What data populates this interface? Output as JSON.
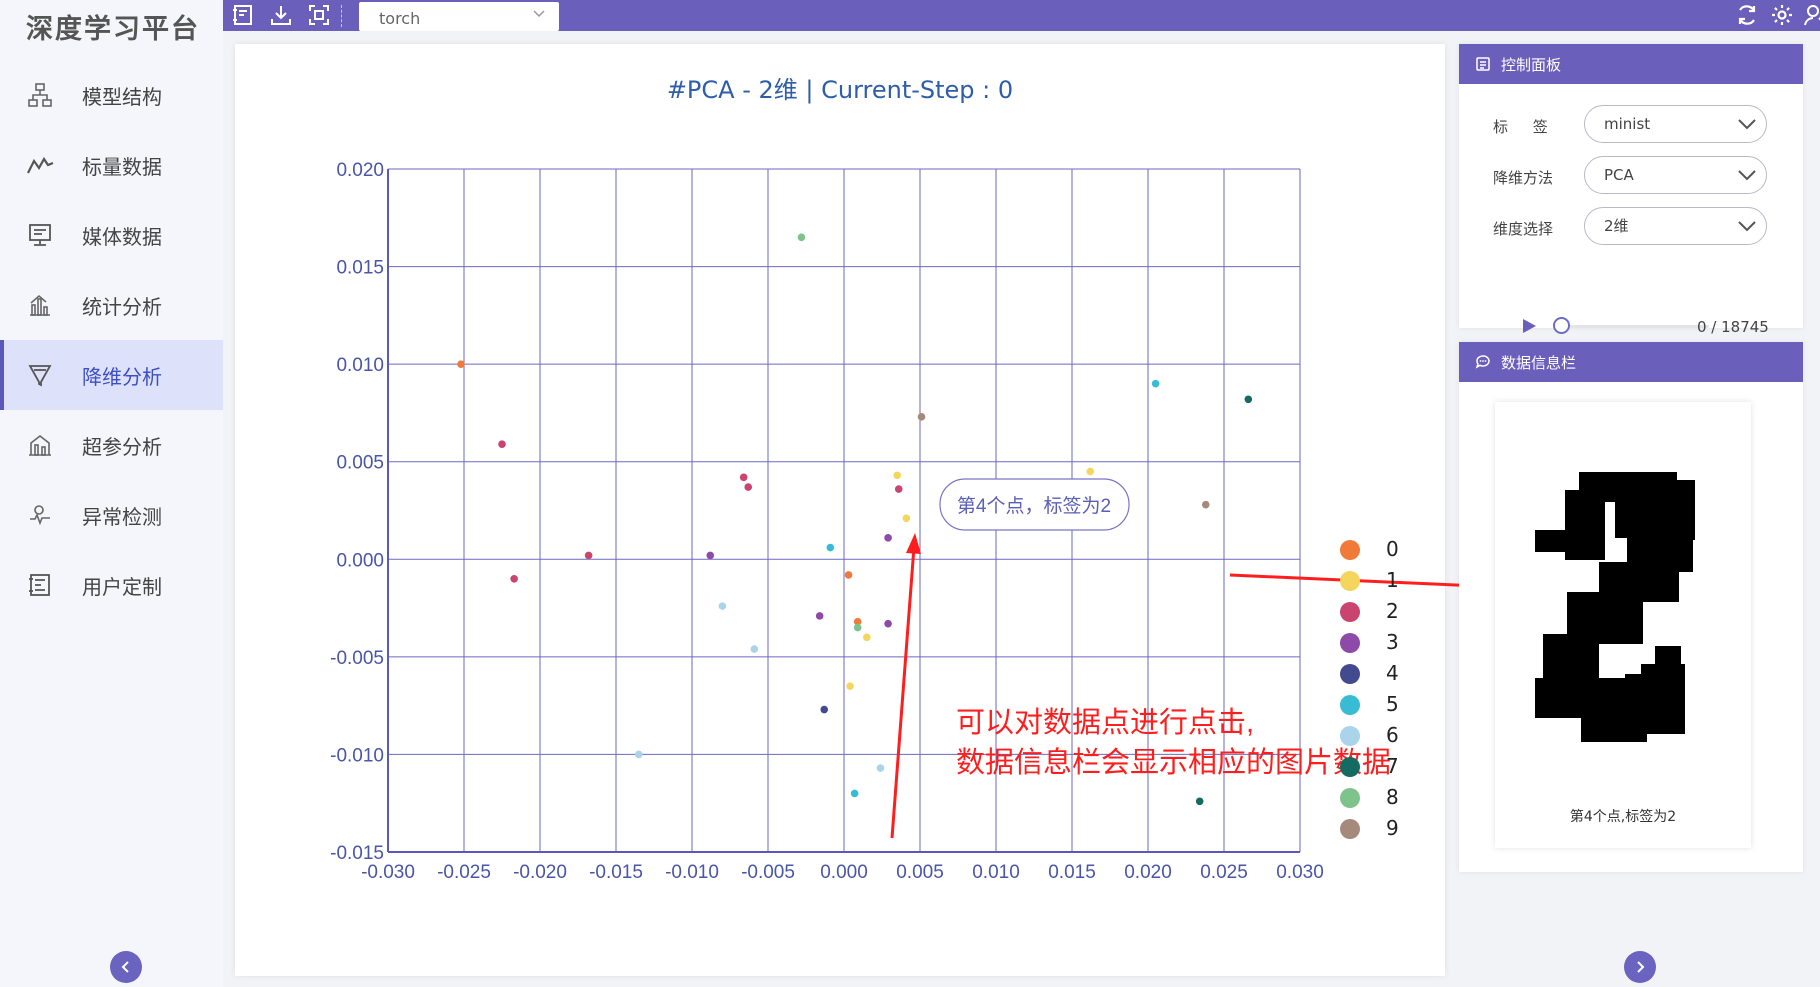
{
  "app": {
    "logo": "深度学习平台"
  },
  "sidebar": {
    "items": [
      {
        "label": "模型结构",
        "icon": "model-structure-icon"
      },
      {
        "label": "标量数据",
        "icon": "line-chart-icon"
      },
      {
        "label": "媒体数据",
        "icon": "monitor-icon"
      },
      {
        "label": "统计分析",
        "icon": "bar-chart-icon"
      },
      {
        "label": "降维分析",
        "icon": "funnel-icon",
        "active": true
      },
      {
        "label": "超参分析",
        "icon": "hyperparam-icon"
      },
      {
        "label": "异常检测",
        "icon": "anomaly-icon"
      },
      {
        "label": "用户定制",
        "icon": "custom-icon"
      }
    ]
  },
  "topbar": {
    "run_select": "torch"
  },
  "chart": {
    "title": "#PCA - 2维 | Current-Step : 0",
    "tooltip": "第4个点，标签为2",
    "annotation_line1": "可以对数据点进行点击,",
    "annotation_line2": "数据信息栏会显示相应的图片数据"
  },
  "chart_data": {
    "type": "scatter",
    "title": "#PCA - 2维 | Current-Step : 0",
    "xlim": [
      -0.03,
      0.03
    ],
    "ylim": [
      -0.015,
      0.02
    ],
    "x_ticks": [
      "-0.030",
      "-0.025",
      "-0.020",
      "-0.015",
      "-0.010",
      "-0.005",
      "0.000",
      "0.005",
      "0.010",
      "0.015",
      "0.020",
      "0.025",
      "0.030"
    ],
    "y_ticks": [
      "0.020",
      "0.015",
      "0.010",
      "0.005",
      "0.000",
      "-0.005",
      "-0.010",
      "-0.015"
    ],
    "grid": true,
    "legend": "right",
    "series": [
      {
        "name": "0",
        "color": "#f07a3a",
        "points": [
          [
            -0.0252,
            0.01
          ],
          [
            0.0003,
            -0.0008
          ],
          [
            0.0009,
            -0.0032
          ]
        ]
      },
      {
        "name": "1",
        "color": "#f4d65e",
        "points": [
          [
            0.0035,
            0.0043
          ],
          [
            0.0041,
            0.0021
          ],
          [
            0.0162,
            0.0045
          ],
          [
            0.0015,
            -0.004
          ],
          [
            0.0004,
            -0.0065
          ]
        ]
      },
      {
        "name": "2",
        "color": "#c9446f",
        "points": [
          [
            -0.0225,
            0.0059
          ],
          [
            -0.0217,
            -0.001
          ],
          [
            -0.0168,
            0.0002
          ],
          [
            -0.0066,
            0.0042
          ],
          [
            -0.0063,
            0.0037
          ],
          [
            0.0036,
            0.0036
          ]
        ]
      },
      {
        "name": "3",
        "color": "#8e4aa8",
        "points": [
          [
            -0.0088,
            0.0002
          ],
          [
            0.0029,
            0.0011
          ],
          [
            -0.0016,
            -0.0029
          ],
          [
            0.0029,
            -0.0033
          ]
        ]
      },
      {
        "name": "4",
        "color": "#434a8f",
        "points": [
          [
            -0.0013,
            -0.0077
          ]
        ]
      },
      {
        "name": "5",
        "color": "#38bcd6",
        "points": [
          [
            -0.0009,
            0.0006
          ],
          [
            0.0205,
            0.009
          ],
          [
            0.0007,
            -0.012
          ]
        ]
      },
      {
        "name": "6",
        "color": "#a9d4ea",
        "points": [
          [
            -0.008,
            -0.0024
          ],
          [
            -0.0059,
            -0.0046
          ],
          [
            -0.0135,
            -0.01
          ],
          [
            0.0024,
            -0.0107
          ]
        ]
      },
      {
        "name": "7",
        "color": "#136b62",
        "points": [
          [
            0.0266,
            0.0082
          ],
          [
            0.0234,
            -0.0124
          ]
        ]
      },
      {
        "name": "8",
        "color": "#7fc38c",
        "points": [
          [
            -0.0028,
            0.0165
          ],
          [
            0.0009,
            -0.0035
          ]
        ]
      },
      {
        "name": "9",
        "color": "#a58a7c",
        "points": [
          [
            0.0051,
            0.0073
          ],
          [
            0.0238,
            0.0028
          ]
        ]
      }
    ]
  },
  "control_panel": {
    "title": "控制面板",
    "label_field": "标 签",
    "label_value": "minist",
    "method_field": "降维方法",
    "method_value": "PCA",
    "dim_field": "维度选择",
    "dim_value": "2维",
    "progress_text": "0 / 18745",
    "progress_fraction": 0
  },
  "info_panel": {
    "title": "数据信息栏",
    "caption": "第4个点,标签为2"
  },
  "colors": {
    "accent": "#6a5fbb",
    "annotation": "#ff1e1e",
    "title": "#2e5daa"
  }
}
